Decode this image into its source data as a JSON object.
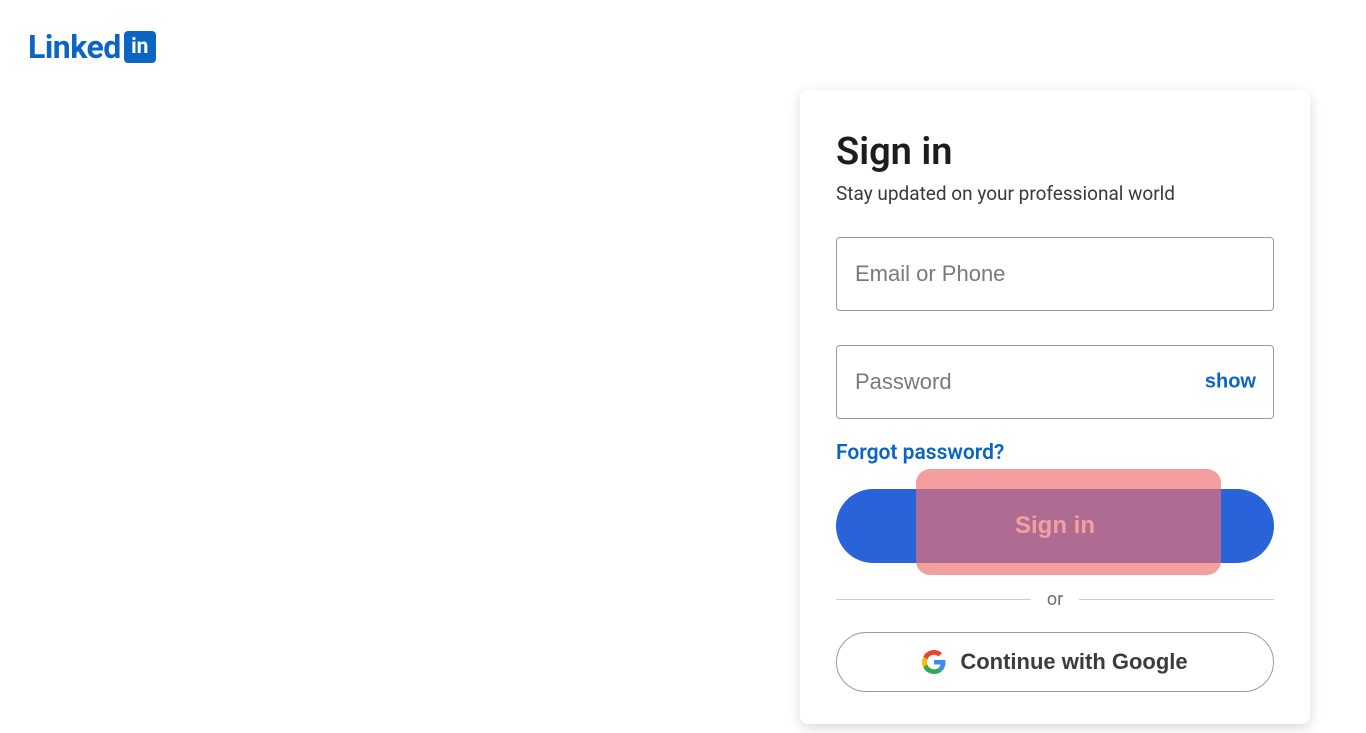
{
  "logo": {
    "text": "Linked",
    "suffix": "in"
  },
  "card": {
    "title": "Sign in",
    "subtitle": "Stay updated on your professional world",
    "email_placeholder": "Email or Phone",
    "password_placeholder": "Password",
    "show_label": "show",
    "forgot_label": "Forgot password?",
    "signin_label": "Sign in",
    "divider_label": "or",
    "google_label": "Continue with Google"
  }
}
